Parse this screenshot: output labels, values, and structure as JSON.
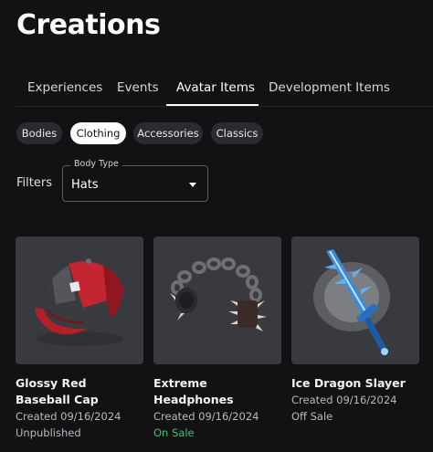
{
  "page_title": "Creations",
  "tabs": [
    {
      "label": "Experiences",
      "active": false
    },
    {
      "label": "Events",
      "active": false
    },
    {
      "label": "Avatar Items",
      "active": true
    },
    {
      "label": "Development Items",
      "active": false
    }
  ],
  "categories": [
    {
      "label": "Bodies",
      "active": false
    },
    {
      "label": "Clothing",
      "active": true
    },
    {
      "label": "Accessories",
      "active": false
    },
    {
      "label": "Classics",
      "active": false
    }
  ],
  "filters": {
    "label": "Filters",
    "body_type_legend": "Body Type",
    "body_type_value": "Hats"
  },
  "items": [
    {
      "name": "Glossy Red Baseball Cap",
      "created": "Created 09/16/2024",
      "status": "Unpublished",
      "status_color": "#b9b9bd",
      "icon": "baseball-cap"
    },
    {
      "name": "Extreme Headphones",
      "created": "Created 09/16/2024",
      "status": "On Sale",
      "status_color": "#3ec46d",
      "icon": "headphones"
    },
    {
      "name": "Ice Dragon Slayer",
      "created": "Created 09/16/2024",
      "status": "Off Sale",
      "status_color": "#b9b9bd",
      "icon": "ice-sword"
    }
  ],
  "colors": {
    "background": "#121215",
    "chip": "#2a2b30",
    "card": "#393a3f",
    "on_sale": "#3ec46d"
  }
}
